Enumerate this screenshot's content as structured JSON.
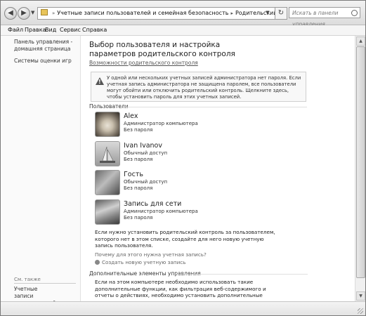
{
  "address": {
    "crumbs": [
      "Учетные записи пользователей и семейная безопасность",
      "Родительский контроль"
    ],
    "search_placeholder": "Искать в панели управления"
  },
  "menu": [
    "Файл",
    "Правка",
    "Вид",
    "Сервис",
    "Справка"
  ],
  "sidebar": {
    "links": [
      "Панель управления - домашняя страница",
      "Системы оценки игр"
    ],
    "see_also_label": "См. также",
    "see_also_links": [
      "Учетные записи пользователей"
    ]
  },
  "main": {
    "title": "Выбор пользователя и настройка параметров родительского контроля",
    "subtitle_link": "Возможности родительского контроля",
    "warning": "У одной или нескольких учетных записей администратора нет пароля. Если учетная запись администратора не защищена паролем, все пользователи могут обойти или отключить родительский контроль. Щелкните здесь, чтобы установить пароль для этих учетных записей.",
    "users_label": "Пользователи",
    "users": [
      {
        "name": "Alex",
        "role": "Администратор компьютера",
        "password": "Без пароля"
      },
      {
        "name": "Ivan Ivanov",
        "role": "Обычный доступ",
        "password": "Без пароля"
      },
      {
        "name": "Гость",
        "role": "Обычный доступ",
        "password": "Без пароля"
      },
      {
        "name": "Запись для сети",
        "role": "Администратор компьютера",
        "password": "Без пароля"
      }
    ],
    "info": "Если нужно установить родительский контроль за пользователем, которого нет в этом списке, создайте для него новую учетную запись пользователя.",
    "why_link": "Почему для этого нужна учетная запись?",
    "create_link": "Создать новую учетную запись",
    "additional_label": "Дополнительные элементы управления",
    "additional_info": "Если на этом компьютере необходимо использовать такие дополнительные функции, как фильтрация веб-содержимого и отчеты о действиях, необходимо установить дополнительные элементы управления."
  }
}
